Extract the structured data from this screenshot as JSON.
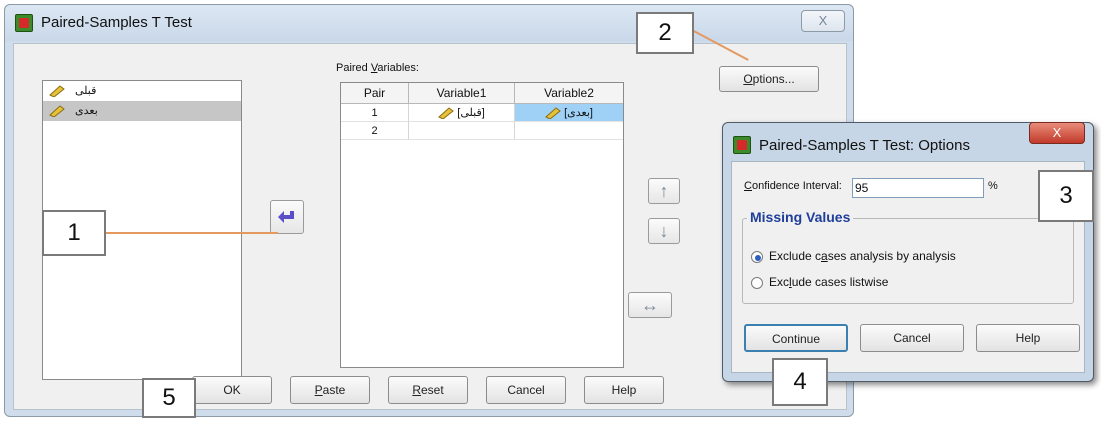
{
  "main_dialog": {
    "title": "Paired-Samples T Test",
    "close_glyph": "X",
    "variables": [
      {
        "label": "قبلى"
      },
      {
        "label": "بعدى"
      }
    ],
    "paired_label_pre": "Paired ",
    "paired_label_u": "V",
    "paired_label_post": "ariables:",
    "table": {
      "headers": [
        "Pair",
        "Variable1",
        "Variable2"
      ],
      "rows": [
        {
          "pair": "1",
          "v1": "[قبلى]",
          "v2": "[بعدى]"
        },
        {
          "pair": "2",
          "v1": "",
          "v2": ""
        }
      ]
    },
    "options_u": "O",
    "options_rest": "ptions...",
    "buttons": {
      "ok": "OK",
      "paste_u": "P",
      "paste_rest": "aste",
      "reset_u": "R",
      "reset_rest": "eset",
      "cancel": "Cancel",
      "help": "Help"
    },
    "arrow_up": "↑",
    "arrow_down": "↓",
    "arrow_swap": "↔"
  },
  "options_dialog": {
    "title": "Paired-Samples T Test: Options",
    "close_glyph": "X",
    "ci_label_u": "C",
    "ci_label_rest": "onfidence Interval:",
    "ci_value": "95",
    "ci_unit": "%",
    "missing_values_title": "Missing Values",
    "radio1_pre": "Exclude c",
    "radio1_u": "a",
    "radio1_post": "ses analysis by analysis",
    "radio2_pre": "Exc",
    "radio2_u": "l",
    "radio2_post": "ude cases listwise",
    "continue": "Continue",
    "cancel": "Cancel",
    "help": "Help"
  },
  "callouts": [
    "1",
    "2",
    "3",
    "4",
    "5"
  ]
}
